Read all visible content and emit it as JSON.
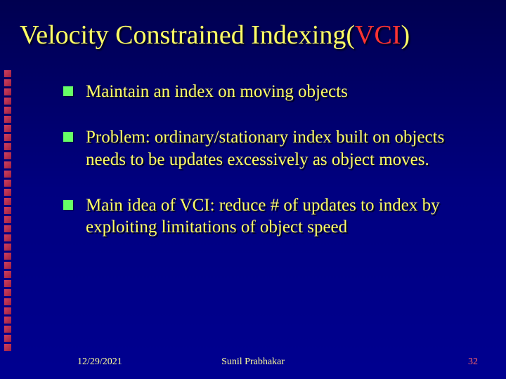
{
  "title": {
    "prefix": "Velocity Constrained Indexing(",
    "accent": "VCI",
    "suffix": ")"
  },
  "bullets": [
    "Maintain an index on moving objects",
    "Problem: ordinary/stationary index built on objects needs to be updates excessively as object moves.",
    "Main idea of VCI: reduce # of updates to index by exploiting limitations of object speed"
  ],
  "footer": {
    "date": "12/29/2021",
    "author": "Sunil Prabhakar",
    "page": "32"
  }
}
